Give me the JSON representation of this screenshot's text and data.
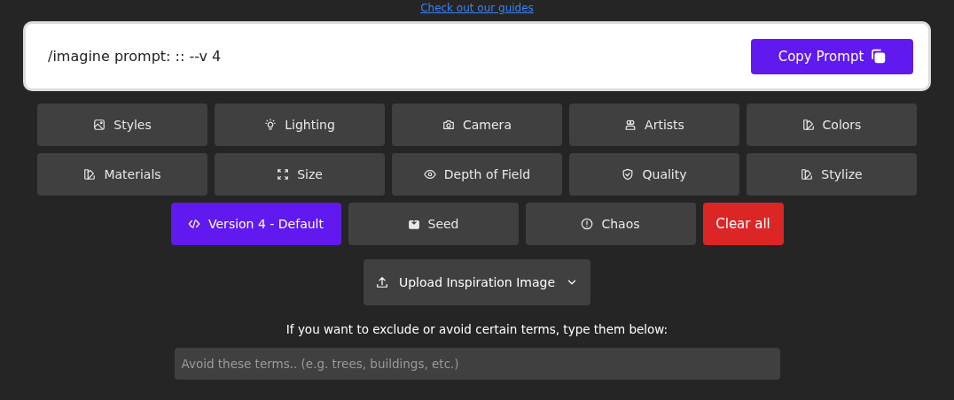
{
  "guides_link": "Check out our guides",
  "prompt": {
    "text": "/imagine prompt: :: --v 4",
    "copy_button": "Copy Prompt"
  },
  "options": [
    {
      "label": "Styles",
      "kind": "option",
      "selected": false
    },
    {
      "label": "Lighting",
      "kind": "option",
      "selected": false
    },
    {
      "label": "Camera",
      "kind": "option",
      "selected": false
    },
    {
      "label": "Artists",
      "kind": "option",
      "selected": false
    },
    {
      "label": "Colors",
      "kind": "option",
      "selected": false
    },
    {
      "label": "Materials",
      "kind": "option",
      "selected": false
    },
    {
      "label": "Size",
      "kind": "option",
      "selected": false
    },
    {
      "label": "Depth of Field",
      "kind": "option",
      "selected": false
    },
    {
      "label": "Quality",
      "kind": "option",
      "selected": false
    },
    {
      "label": "Stylize",
      "kind": "option",
      "selected": false
    },
    {
      "label": "Version 4 - Default",
      "kind": "option",
      "selected": true
    },
    {
      "label": "Seed",
      "kind": "option",
      "selected": false
    },
    {
      "label": "Chaos",
      "kind": "option",
      "selected": false
    },
    {
      "label": "Clear all",
      "kind": "clear"
    }
  ],
  "upload_button": "Upload Inspiration Image",
  "exclude_hint": "If you want to exclude or avoid certain terms, type them below:",
  "exclude_field": {
    "placeholder": "Avoid these terms.. (e.g. trees, buildings, etc.)"
  }
}
